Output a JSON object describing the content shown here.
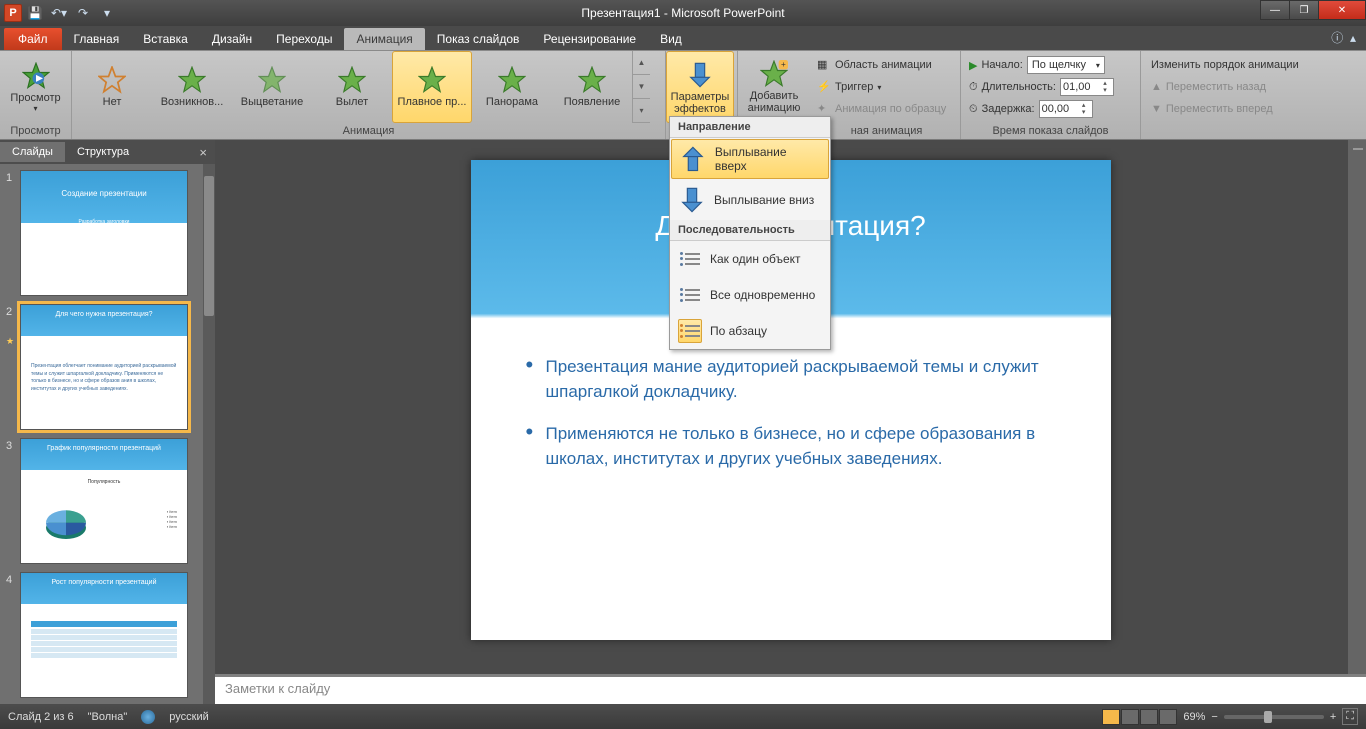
{
  "app": {
    "title": "Презентация1 - Microsoft PowerPoint"
  },
  "qat": {
    "save": "💾",
    "undo": "↶",
    "redo": "↷"
  },
  "tabs": {
    "file": "Файл",
    "items": [
      "Главная",
      "Вставка",
      "Дизайн",
      "Переходы",
      "Анимация",
      "Показ слайдов",
      "Рецензирование",
      "Вид"
    ],
    "active_index": 4
  },
  "ribbon": {
    "preview": {
      "label": "Просмотр",
      "group": "Просмотр"
    },
    "animation": {
      "group": "Анимация",
      "items": [
        "Нет",
        "Возникнов...",
        "Выцветание",
        "Вылет",
        "Плавное пр...",
        "Панорама",
        "Появление"
      ],
      "selected_index": 4
    },
    "effect_opts": {
      "btn": "Параметры\nэффектов",
      "drop": "▾"
    },
    "add_anim": {
      "btn": "Добавить\nанимацию",
      "drop": "▾"
    },
    "adv": {
      "pane": "Область анимации",
      "trigger": "Триггер",
      "painter": "Анимация по образцу",
      "group": "ная анимация"
    },
    "timing": {
      "start_lbl": "Начало:",
      "start_val": "По щелчку",
      "dur_lbl": "Длительность:",
      "dur_val": "01,00",
      "delay_lbl": "Задержка:",
      "delay_val": "00,00",
      "group": "Время показа слайдов"
    },
    "reorder": {
      "title": "Изменить порядок анимации",
      "back": "Переместить назад",
      "fwd": "Переместить вперед"
    }
  },
  "dropdown": {
    "hdr1": "Направление",
    "up": "Выплывание вверх",
    "down": "Выплывание вниз",
    "hdr2": "Последовательность",
    "seq1": "Как один объект",
    "seq2": "Все одновременно",
    "seq3": "По абзацу"
  },
  "leftpanel": {
    "tab1": "Слайды",
    "tab2": "Структура",
    "slides": [
      {
        "n": "1",
        "title": "Создание презентации",
        "sub": "Разработка заголовки"
      },
      {
        "n": "2",
        "title": "Для чего нужна презентация?",
        "body": "Презентация облегчает понимание аудиторией раскрываемой темы и служит шпаргалкой докладчику. Применяются не только в бизнесе, но и сфере образов ания в школах, институтах и других учебных заведениях."
      },
      {
        "n": "3",
        "title": "График популярности презентаций",
        "chart_caption": "Популярность"
      },
      {
        "n": "4",
        "title": "Рост популярности презентаций"
      }
    ]
  },
  "slide": {
    "title": "Для чего              езентация?",
    "bullets": [
      "Презентация                                 мание аудиторией раскрываемой темы и служит шпаргалкой докладчику.",
      "Применяются не только в бизнесе, но и сфере образования в школах, институтах и других учебных заведениях."
    ]
  },
  "notes": {
    "placeholder": "Заметки к слайду"
  },
  "status": {
    "slide": "Слайд 2 из 6",
    "theme": "\"Волна\"",
    "lang": "русский",
    "zoom": "69%"
  }
}
